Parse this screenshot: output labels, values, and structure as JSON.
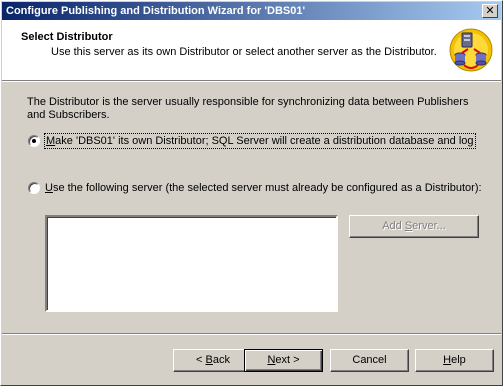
{
  "window": {
    "title": "Configure Publishing and Distribution Wizard for 'DBS01'",
    "close_glyph": "✕"
  },
  "header": {
    "title": "Select Distributor",
    "subtitle": "Use this server as its own Distributor or select another server as the Distributor.",
    "icon": "publishing-distribution-wizard-icon"
  },
  "body": {
    "description": "The Distributor is the server usually responsible for synchronizing data between Publishers and Subscribers.",
    "options": [
      {
        "mnemonic": "M",
        "label_rest": "ake 'DBS01' its own Distributor; SQL Server will create a distribution database and log",
        "selected": true
      },
      {
        "mnemonic": "U",
        "label_rest": "se the following server (the selected server must already be configured as a Distributor):",
        "selected": false
      }
    ],
    "server_list": {
      "items": []
    },
    "add_server": {
      "label_pre": "Add ",
      "mnemonic": "S",
      "label_post": "erver...",
      "enabled": false
    }
  },
  "footer": {
    "back": {
      "label_pre": "< ",
      "mnemonic": "B",
      "label_post": "ack"
    },
    "next": {
      "mnemonic": "N",
      "label_post": "ext >"
    },
    "cancel": {
      "label": "Cancel"
    },
    "help": {
      "mnemonic": "H",
      "label_post": "elp"
    }
  },
  "colors": {
    "titlebar_start": "#0a246a",
    "titlebar_end": "#a6caf0",
    "face": "#d4d0c8"
  }
}
